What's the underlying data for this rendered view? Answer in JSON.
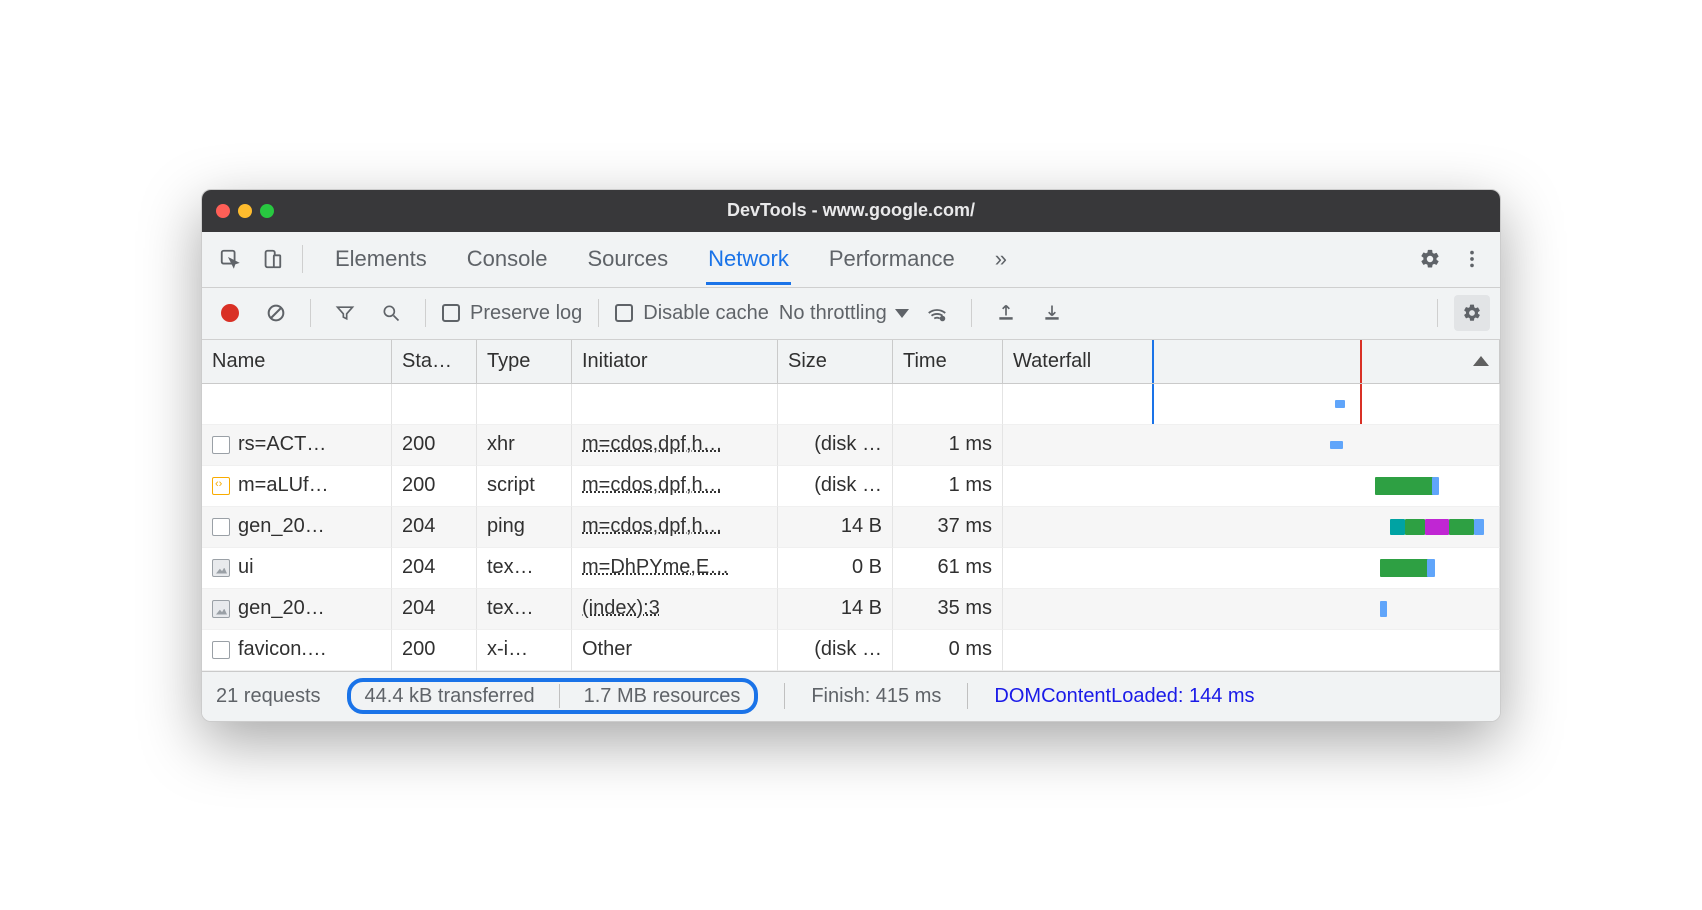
{
  "window": {
    "title": "DevTools - www.google.com/"
  },
  "tabs": {
    "items": [
      "Elements",
      "Console",
      "Sources",
      "Network",
      "Performance"
    ],
    "active_index": 3
  },
  "toolbar": {
    "preserve_log": "Preserve log",
    "disable_cache": "Disable cache",
    "throttling": "No throttling"
  },
  "columns": [
    "Name",
    "Sta…",
    "Type",
    "Initiator",
    "Size",
    "Time",
    "Waterfall"
  ],
  "rows": [
    {
      "icon": "doc",
      "name": "rs=ACT…",
      "status": "200",
      "type": "xhr",
      "initiator": "m=cdos,dpf,h…",
      "size": "(disk …",
      "time": "1 ms"
    },
    {
      "icon": "script",
      "name": "m=aLUf…",
      "status": "200",
      "type": "script",
      "initiator": "m=cdos,dpf,h…",
      "size": "(disk …",
      "time": "1 ms"
    },
    {
      "icon": "doc",
      "name": "gen_20…",
      "status": "204",
      "type": "ping",
      "initiator": "m=cdos,dpf,h…",
      "size": "14 B",
      "time": "37 ms"
    },
    {
      "icon": "img",
      "name": "ui",
      "status": "204",
      "type": "tex…",
      "initiator": "m=DhPYme,E…",
      "size": "0 B",
      "time": "61 ms"
    },
    {
      "icon": "img",
      "name": "gen_20…",
      "status": "204",
      "type": "tex…",
      "initiator": "(index):3",
      "size": "14 B",
      "time": "35 ms"
    },
    {
      "icon": "doc",
      "name": "favicon.…",
      "status": "200",
      "type": "x-i…",
      "initiator": "Other",
      "size": "(disk …",
      "time": "0 ms"
    }
  ],
  "status": {
    "requests": "21 requests",
    "transferred": "44.4 kB transferred",
    "resources": "1.7 MB resources",
    "finish": "Finish: 415 ms",
    "dcl": "DOMContentLoaded: 144 ms"
  }
}
